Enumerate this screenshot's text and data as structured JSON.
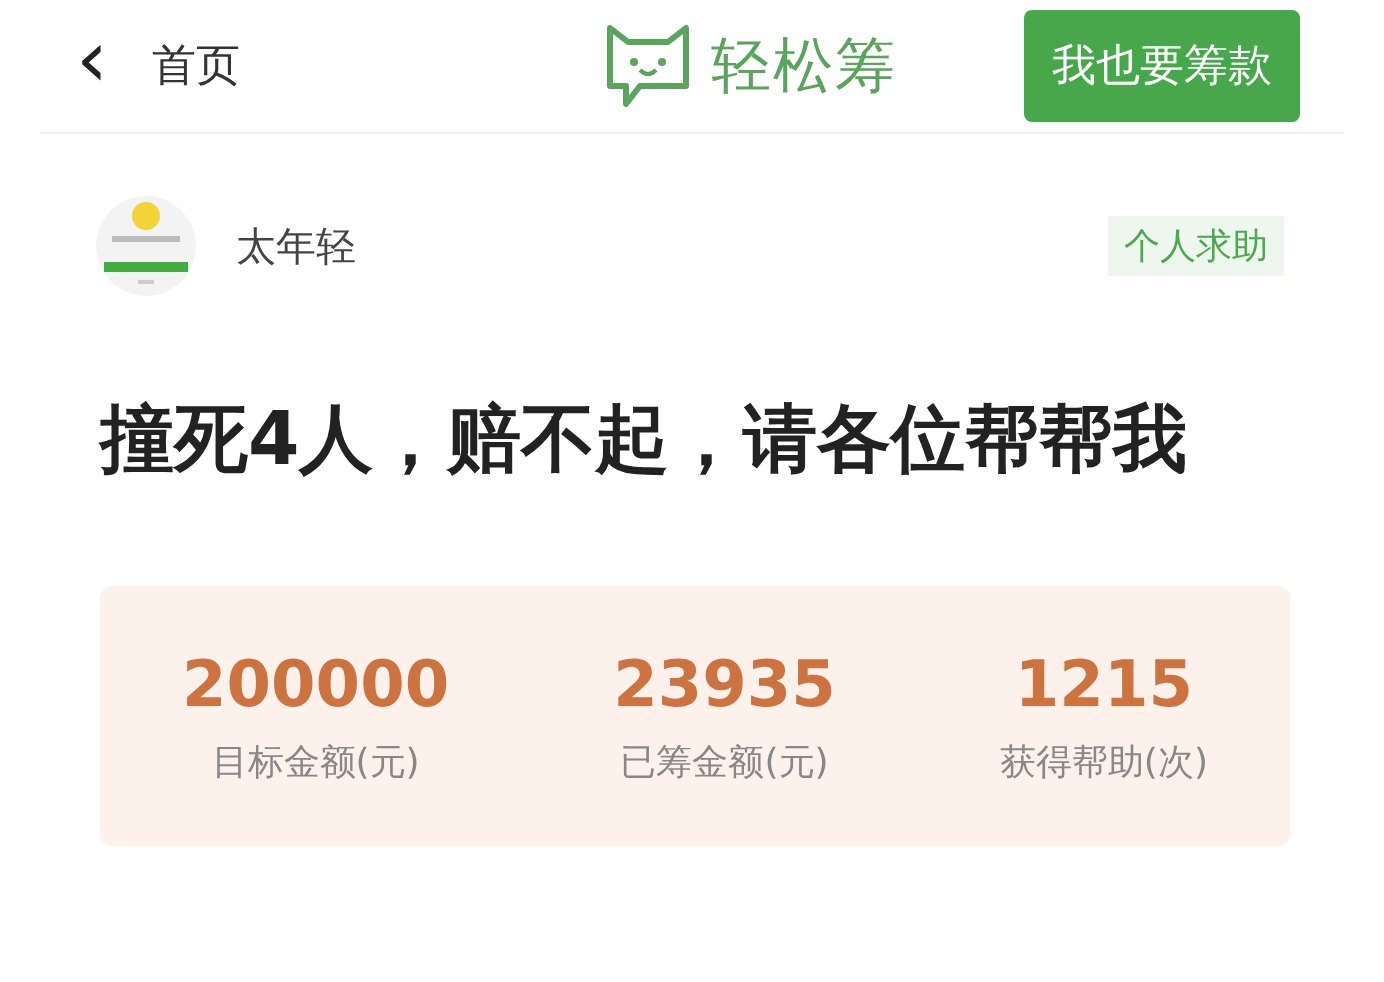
{
  "nav": {
    "back_icon": "‹",
    "back_label": "首页",
    "logo_text": "轻松筹",
    "action_button": "我也要筹款"
  },
  "author": {
    "name": "太年轻",
    "tag": "个人求助"
  },
  "title": "撞死4人，赔不起，请各位帮帮我",
  "stats": [
    {
      "value": "200000",
      "label": "目标金额(元)"
    },
    {
      "value": "23935",
      "label": "已筹金额(元)"
    },
    {
      "value": "1215",
      "label": "获得帮助(次)"
    }
  ]
}
